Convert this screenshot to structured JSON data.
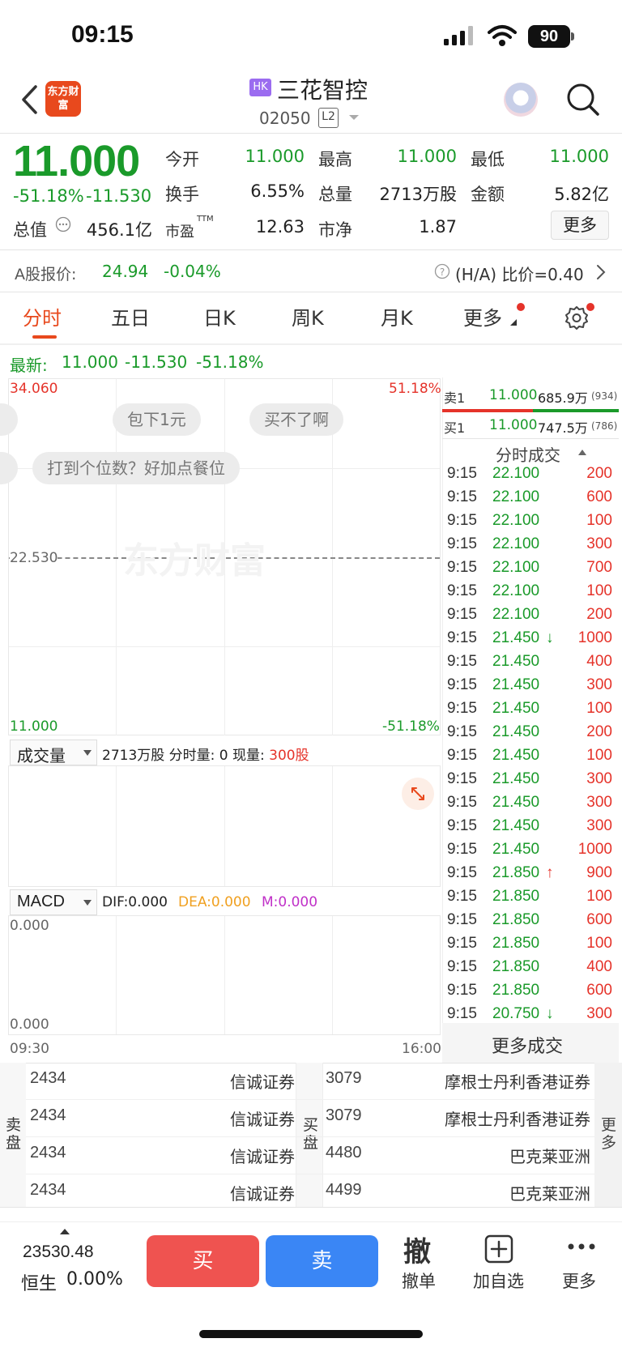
{
  "status_bar": {
    "time": "09:15",
    "battery": "90"
  },
  "header": {
    "logo_text": "东方财富",
    "market_badge": "HK",
    "stock_name": "三花智控",
    "stock_code": "02050",
    "level_badge": "L2"
  },
  "quote": {
    "price": "11.000",
    "change_pct": "-51.18%",
    "change": "-11.530",
    "open_label": "今开",
    "open": "11.000",
    "high_label": "最高",
    "high": "11.000",
    "low_label": "最低",
    "low": "11.000",
    "turnover_label": "换手",
    "turnover": "6.55%",
    "volume_label": "总量",
    "volume": "2713万股",
    "amount_label": "金额",
    "amount": "5.82亿",
    "mktcap_label": "总值",
    "mktcap": "456.1亿",
    "pe_label": "市盈",
    "pe_sup": "TTM",
    "pe": "12.63",
    "pb_label": "市净",
    "pb": "1.87",
    "more_label": "更多"
  },
  "a_share": {
    "label": "A股报价:",
    "price": "24.94",
    "change": "-0.04%",
    "ratio_text": "(H/A) 比价=0.40"
  },
  "tabs": [
    "分时",
    "五日",
    "日K",
    "周K",
    "月K",
    "更多"
  ],
  "latest": {
    "label": "最新:",
    "price": "11.000",
    "change": "-11.530",
    "pct": "-51.18%"
  },
  "chart": {
    "y_top": "34.060",
    "y_mid": "22.530",
    "y_bottom": "11.000",
    "pct_top": "51.18%",
    "pct_bottom": "-51.18%",
    "watermark": "东方财富",
    "bubbles": [
      "包下1元",
      "买不了啊",
      "打到个位数？好加点餐位"
    ],
    "time_start": "09:30",
    "time_end": "16:00"
  },
  "volume_panel": {
    "selector": "成交量",
    "summary": "2713万股 分时量: 0 现量: ",
    "current": "300股"
  },
  "macd_panel": {
    "selector": "MACD",
    "dif": "DIF:0.000",
    "dea": "DEA:0.000",
    "m": "M:0.000",
    "y_top": "0.000",
    "y_bottom": "0.000"
  },
  "order_book": {
    "sell_label": "卖1",
    "sell_price": "11.000",
    "sell_vol": "685.9万",
    "sell_count": "(934)",
    "buy_label": "买1",
    "buy_price": "11.000",
    "buy_vol": "747.5万",
    "buy_count": "(786)"
  },
  "ticks_title": "分时成交",
  "ticks": [
    {
      "time": "9:15",
      "price": "22.100",
      "arrow": "",
      "vol": "200",
      "vcolor": "red"
    },
    {
      "time": "9:15",
      "price": "22.100",
      "arrow": "",
      "vol": "600",
      "vcolor": "red"
    },
    {
      "time": "9:15",
      "price": "22.100",
      "arrow": "",
      "vol": "100",
      "vcolor": "red"
    },
    {
      "time": "9:15",
      "price": "22.100",
      "arrow": "",
      "vol": "300",
      "vcolor": "red"
    },
    {
      "time": "9:15",
      "price": "22.100",
      "arrow": "",
      "vol": "700",
      "vcolor": "red"
    },
    {
      "time": "9:15",
      "price": "22.100",
      "arrow": "",
      "vol": "100",
      "vcolor": "red"
    },
    {
      "time": "9:15",
      "price": "22.100",
      "arrow": "",
      "vol": "200",
      "vcolor": "red"
    },
    {
      "time": "9:15",
      "price": "21.450",
      "arrow": "↓",
      "vol": "1000",
      "vcolor": "red"
    },
    {
      "time": "9:15",
      "price": "21.450",
      "arrow": "",
      "vol": "400",
      "vcolor": "red"
    },
    {
      "time": "9:15",
      "price": "21.450",
      "arrow": "",
      "vol": "300",
      "vcolor": "red"
    },
    {
      "time": "9:15",
      "price": "21.450",
      "arrow": "",
      "vol": "100",
      "vcolor": "red"
    },
    {
      "time": "9:15",
      "price": "21.450",
      "arrow": "",
      "vol": "200",
      "vcolor": "red"
    },
    {
      "time": "9:15",
      "price": "21.450",
      "arrow": "",
      "vol": "100",
      "vcolor": "red"
    },
    {
      "time": "9:15",
      "price": "21.450",
      "arrow": "",
      "vol": "300",
      "vcolor": "red"
    },
    {
      "time": "9:15",
      "price": "21.450",
      "arrow": "",
      "vol": "300",
      "vcolor": "red"
    },
    {
      "time": "9:15",
      "price": "21.450",
      "arrow": "",
      "vol": "300",
      "vcolor": "red"
    },
    {
      "time": "9:15",
      "price": "21.450",
      "arrow": "",
      "vol": "1000",
      "vcolor": "red"
    },
    {
      "time": "9:15",
      "price": "21.850",
      "arrow": "↑",
      "vol": "900",
      "vcolor": "red"
    },
    {
      "time": "9:15",
      "price": "21.850",
      "arrow": "",
      "vol": "100",
      "vcolor": "red"
    },
    {
      "time": "9:15",
      "price": "21.850",
      "arrow": "",
      "vol": "600",
      "vcolor": "red"
    },
    {
      "time": "9:15",
      "price": "21.850",
      "arrow": "",
      "vol": "100",
      "vcolor": "red"
    },
    {
      "time": "9:15",
      "price": "21.850",
      "arrow": "",
      "vol": "400",
      "vcolor": "red"
    },
    {
      "time": "9:15",
      "price": "21.850",
      "arrow": "",
      "vol": "600",
      "vcolor": "red"
    },
    {
      "time": "9:15",
      "price": "20.750",
      "arrow": "↓",
      "vol": "300",
      "vcolor": "red"
    }
  ],
  "more_ticks": "更多成交",
  "brokers": {
    "sell_label": "卖盘",
    "buy_label": "买盘",
    "more_label": "更多",
    "sell": [
      {
        "code": "2434",
        "name": "信诚证券"
      },
      {
        "code": "2434",
        "name": "信诚证券"
      },
      {
        "code": "2434",
        "name": "信诚证券"
      },
      {
        "code": "2434",
        "name": "信诚证券"
      }
    ],
    "buy": [
      {
        "code": "3079",
        "name": "摩根士丹利香港证券"
      },
      {
        "code": "3079",
        "name": "摩根士丹利香港证券"
      },
      {
        "code": "4480",
        "name": "巴克莱亚洲"
      },
      {
        "code": "4499",
        "name": "巴克莱亚洲"
      }
    ]
  },
  "bottom_bar": {
    "index_value": "23530.48",
    "index_name": "恒生",
    "index_change": "0.00%",
    "buy": "买",
    "sell": "卖",
    "cancel_icon": "撤",
    "cancel": "撤单",
    "add_watch": "加自选",
    "more": "更多"
  },
  "colors": {
    "up": "#e5332a",
    "down": "#1a9a2a",
    "accent": "#e8491d",
    "buy_button": "#ef5350",
    "sell_button": "#3a86f5"
  }
}
